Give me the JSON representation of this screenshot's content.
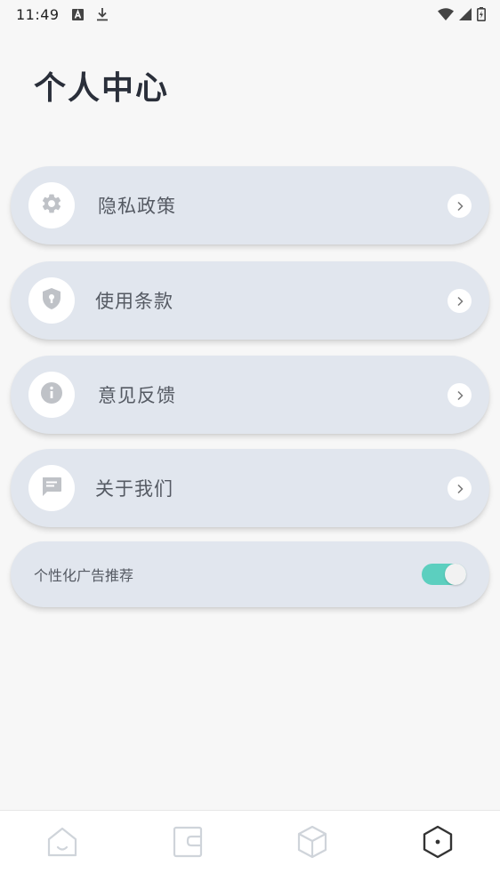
{
  "status_bar": {
    "time": "11:49",
    "left_icons": [
      "a-box-icon",
      "download-icon"
    ],
    "right_icons": [
      "wifi-icon",
      "signal-icon",
      "battery-charging-icon"
    ]
  },
  "page": {
    "title": "个人中心"
  },
  "menu": {
    "items": [
      {
        "label": "隐私政策",
        "icon": "gear-icon"
      },
      {
        "label": "使用条款",
        "icon": "shield-lock-icon"
      },
      {
        "label": "意见反馈",
        "icon": "info-icon"
      },
      {
        "label": "关于我们",
        "icon": "chat-bubble-icon"
      }
    ]
  },
  "ad_toggle": {
    "label": "个性化广告推荐",
    "enabled": true
  },
  "bottom_nav": {
    "items": [
      {
        "icon": "home-icon",
        "active": false
      },
      {
        "icon": "wallet-icon",
        "active": false
      },
      {
        "icon": "cube-icon",
        "active": false
      },
      {
        "icon": "hexagon-profile-icon",
        "active": true
      }
    ]
  },
  "colors": {
    "card": "#e1e6ee",
    "toggle_on": "#5ccfbf",
    "icon_gray": "#bfc2c7",
    "nav_inactive": "#cfd4da",
    "nav_active": "#333333"
  }
}
